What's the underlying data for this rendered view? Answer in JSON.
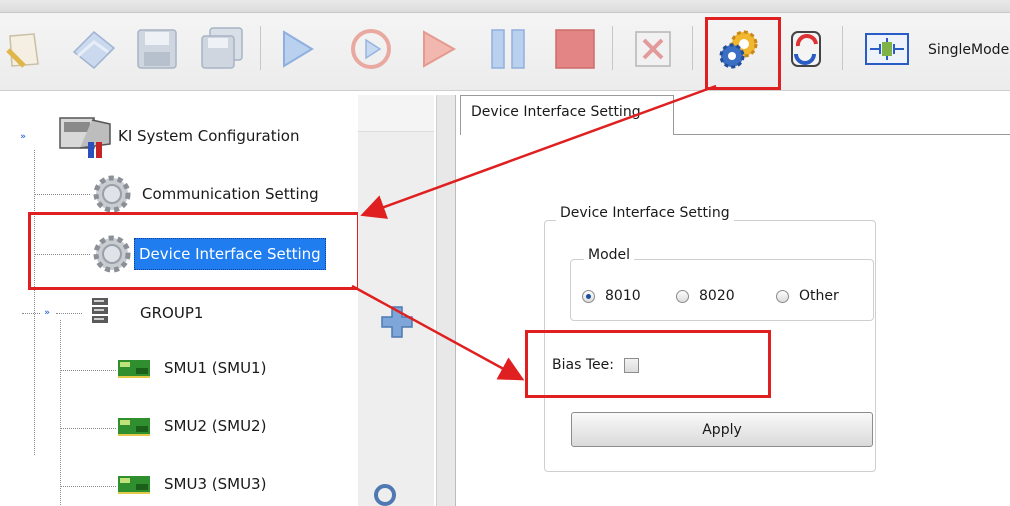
{
  "toolbar": {
    "icons": [
      "new-file-icon",
      "open-icon",
      "save-icon",
      "save-all-icon",
      "run-icon",
      "repeat-run-icon",
      "step-icon",
      "pause-icon",
      "stop-icon",
      "clear-icon",
      "settings-gears-icon",
      "refresh-icon",
      "single-mode-icon"
    ],
    "mode_label": "SingleMode"
  },
  "tree": {
    "root": "KI System Configuration",
    "items": [
      {
        "label": "Communication Setting",
        "icon": "gear-icon"
      },
      {
        "label": "Device Interface Setting",
        "icon": "gear-icon",
        "selected": true
      },
      {
        "label": "GROUP1",
        "icon": "server-stack-icon"
      },
      {
        "label": "SMU1 (SMU1)",
        "icon": "smu-board-icon"
      },
      {
        "label": "SMU2 (SMU2)",
        "icon": "smu-board-icon"
      },
      {
        "label": "SMU3 (SMU3)",
        "icon": "smu-board-icon"
      }
    ]
  },
  "panel": {
    "tab_label": "Device Interface Setting",
    "group_title": "Device Interface Setting",
    "model_title": "Model",
    "models": [
      {
        "label": "8010",
        "selected": true
      },
      {
        "label": "8020",
        "selected": false
      },
      {
        "label": "Other",
        "selected": false
      }
    ],
    "bias_tee_label": "Bias Tee:",
    "bias_tee_checked": false,
    "apply_label": "Apply"
  },
  "colors": {
    "highlight": "#e02020",
    "selection": "#1f7df0"
  }
}
